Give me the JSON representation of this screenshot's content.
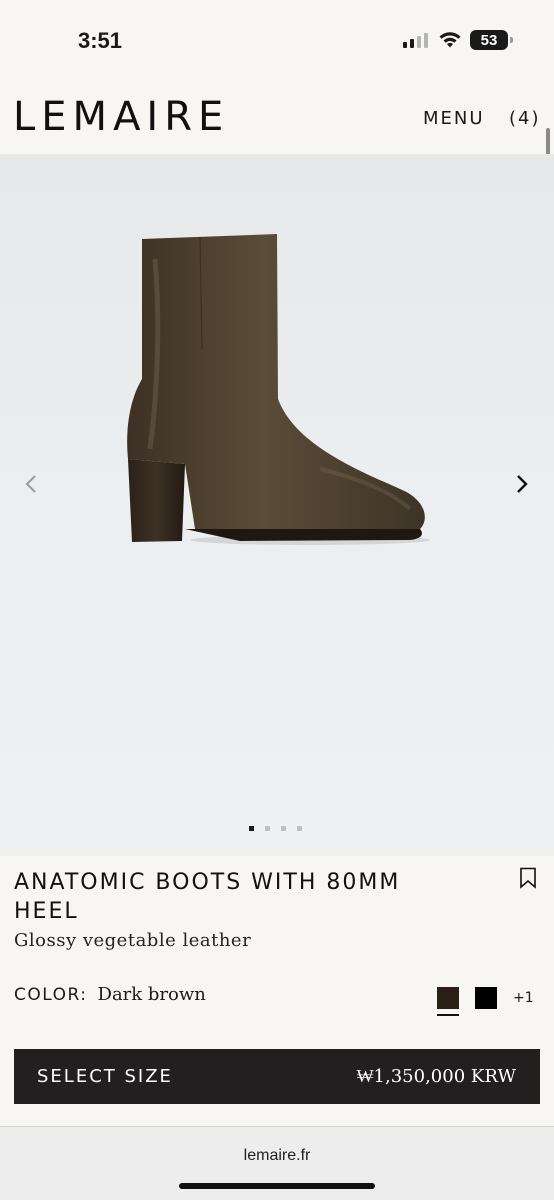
{
  "status": {
    "time": "3:51",
    "battery": "53"
  },
  "header": {
    "logo": "LEMAIRE",
    "menu_label": "MENU",
    "cart_label": "(4)"
  },
  "gallery": {
    "image_count": 4,
    "active_index": 0
  },
  "product": {
    "title": "ANATOMIC BOOTS WITH 80MM HEEL",
    "subtitle": "Glossy vegetable leather",
    "color_label": "COLOR:",
    "color_value": "Dark brown",
    "swatches": [
      {
        "name": "Dark brown",
        "hex": "#2a1f17",
        "selected": true
      },
      {
        "name": "Black",
        "hex": "#000000",
        "selected": false
      }
    ],
    "more_swatches": "+1",
    "select_size_label": "SELECT SIZE",
    "price": "₩1,350,000 KRW"
  },
  "browser": {
    "url": "lemaire.fr"
  },
  "colors": {
    "page_bg": "#f7f6f3",
    "cta_bg": "#231f20",
    "boot": "#4a3d2c"
  }
}
